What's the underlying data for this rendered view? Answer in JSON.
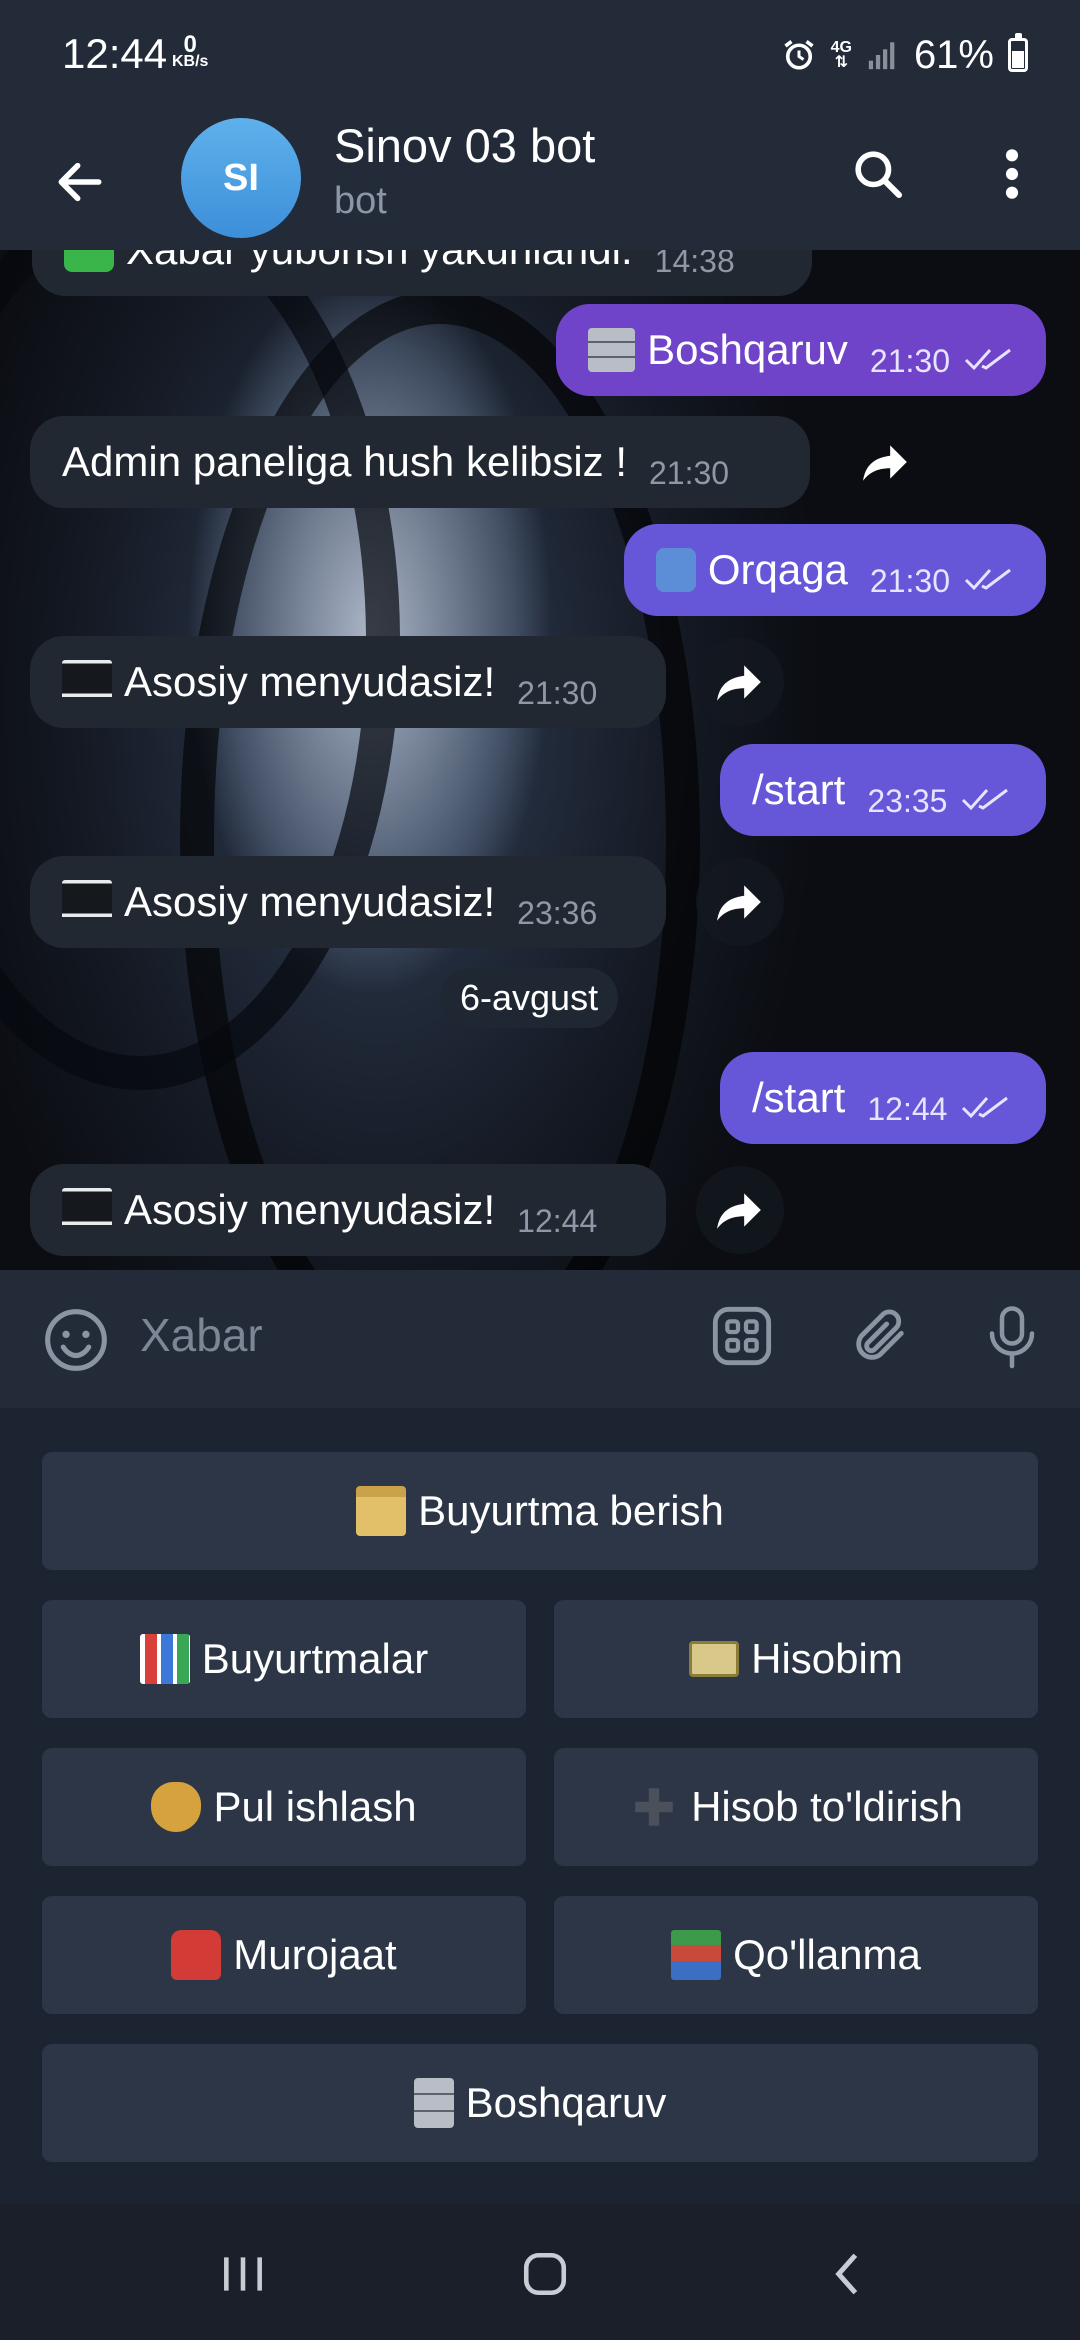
{
  "status": {
    "time": "12:44",
    "speed_value": "0",
    "speed_unit": "KB/s",
    "network": "4G",
    "battery": "61%",
    "battery_level": 0.61
  },
  "header": {
    "avatar_initials": "SI",
    "title": "Sinov 03 bot",
    "subtitle": "bot",
    "avatar_color": "#4a9fe3"
  },
  "chat": {
    "partial_message": {
      "text": "Xabar yuborish yakunlandi.",
      "time": "14:38"
    },
    "messages": [
      {
        "dir": "out",
        "text": "Boshqaruv",
        "time": "21:30",
        "icon": "file-cabinet-icon"
      },
      {
        "dir": "in",
        "text": "Admin paneliga hush kelibsiz !",
        "time": "21:30"
      },
      {
        "dir": "out",
        "text": "Orqaga",
        "time": "21:30",
        "icon": "rewind-icon"
      },
      {
        "dir": "in",
        "text": "Asosiy menyudasiz!",
        "time": "21:30",
        "icon": "monitor-icon"
      },
      {
        "dir": "out",
        "text": "/start",
        "time": "23:35"
      },
      {
        "dir": "in",
        "text": "Asosiy menyudasiz!",
        "time": "23:36",
        "icon": "monitor-icon"
      },
      {
        "dir": "out",
        "text": "/start",
        "time": "12:44"
      },
      {
        "dir": "in",
        "text": "Asosiy menyudasiz!",
        "time": "12:44",
        "icon": "monitor-icon"
      }
    ],
    "date_chip": "6-avgust"
  },
  "composer": {
    "placeholder": "Xabar"
  },
  "keyboard": {
    "order_button": "Buyurtma berish",
    "orders_button": "Buyurtmalar",
    "account_button": "Hisobim",
    "earn_button": "Pul ishlash",
    "topup_button": "Hisob to'ldirish",
    "contact_button": "Murojaat",
    "guide_button": "Qo'llanma",
    "admin_button": "Boshqaruv"
  },
  "colors": {
    "outgoing_bubble": "#6656d8",
    "incoming_bubble": "#222832",
    "header_bg": "#232b39",
    "keyboard_key": "#2c3646"
  }
}
